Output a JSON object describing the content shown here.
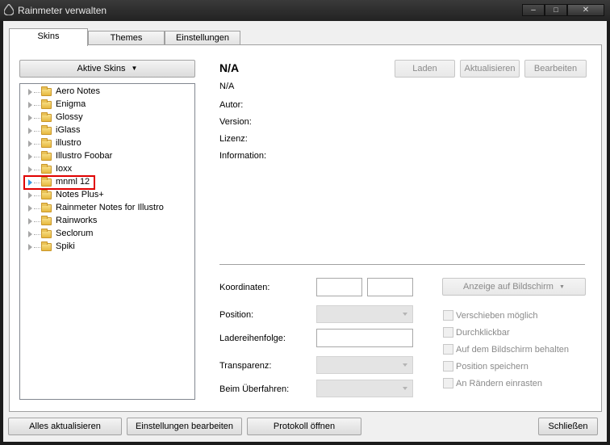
{
  "window": {
    "title": "Rainmeter verwalten",
    "minimize": "–",
    "maximize": "□",
    "close": "✕"
  },
  "tabs": [
    {
      "label": "Skins",
      "active": true
    },
    {
      "label": "Themes"
    },
    {
      "label": "Einstellungen"
    }
  ],
  "skins": {
    "active_skins_button": "Aktive Skins",
    "tree": [
      "Aero Notes",
      "Enigma",
      "Glossy",
      "iGlass",
      "illustro",
      "Illustro Foobar",
      "Ioxx",
      "mnml 12",
      "Notes Plus+",
      "Rainmeter Notes for Illustro",
      "Rainworks",
      "Seclorum",
      "Spiki"
    ],
    "highlighted_item": "mnml 12"
  },
  "details": {
    "name": "N/A",
    "file": "N/A",
    "author_label": "Autor:",
    "version_label": "Version:",
    "license_label": "Lizenz:",
    "info_label": "Information:",
    "load_button": "Laden",
    "refresh_button": "Aktualisieren",
    "edit_button": "Bearbeiten"
  },
  "settings": {
    "coordinates_label": "Koordinaten:",
    "position_label": "Position:",
    "load_order_label": "Ladereihenfolge:",
    "transparency_label": "Transparenz:",
    "on_hover_label": "Beim Überfahren:",
    "display_button": "Anzeige auf Bildschirm",
    "checkboxes": [
      "Verschieben möglich",
      "Durchklickbar",
      "Auf dem Bildschirm behalten",
      "Position speichern",
      "An Rändern einrasten"
    ]
  },
  "footer": {
    "refresh_all": "Alles aktualisieren",
    "edit_settings": "Einstellungen bearbeiten",
    "open_log": "Protokoll öffnen",
    "close": "Schließen"
  }
}
